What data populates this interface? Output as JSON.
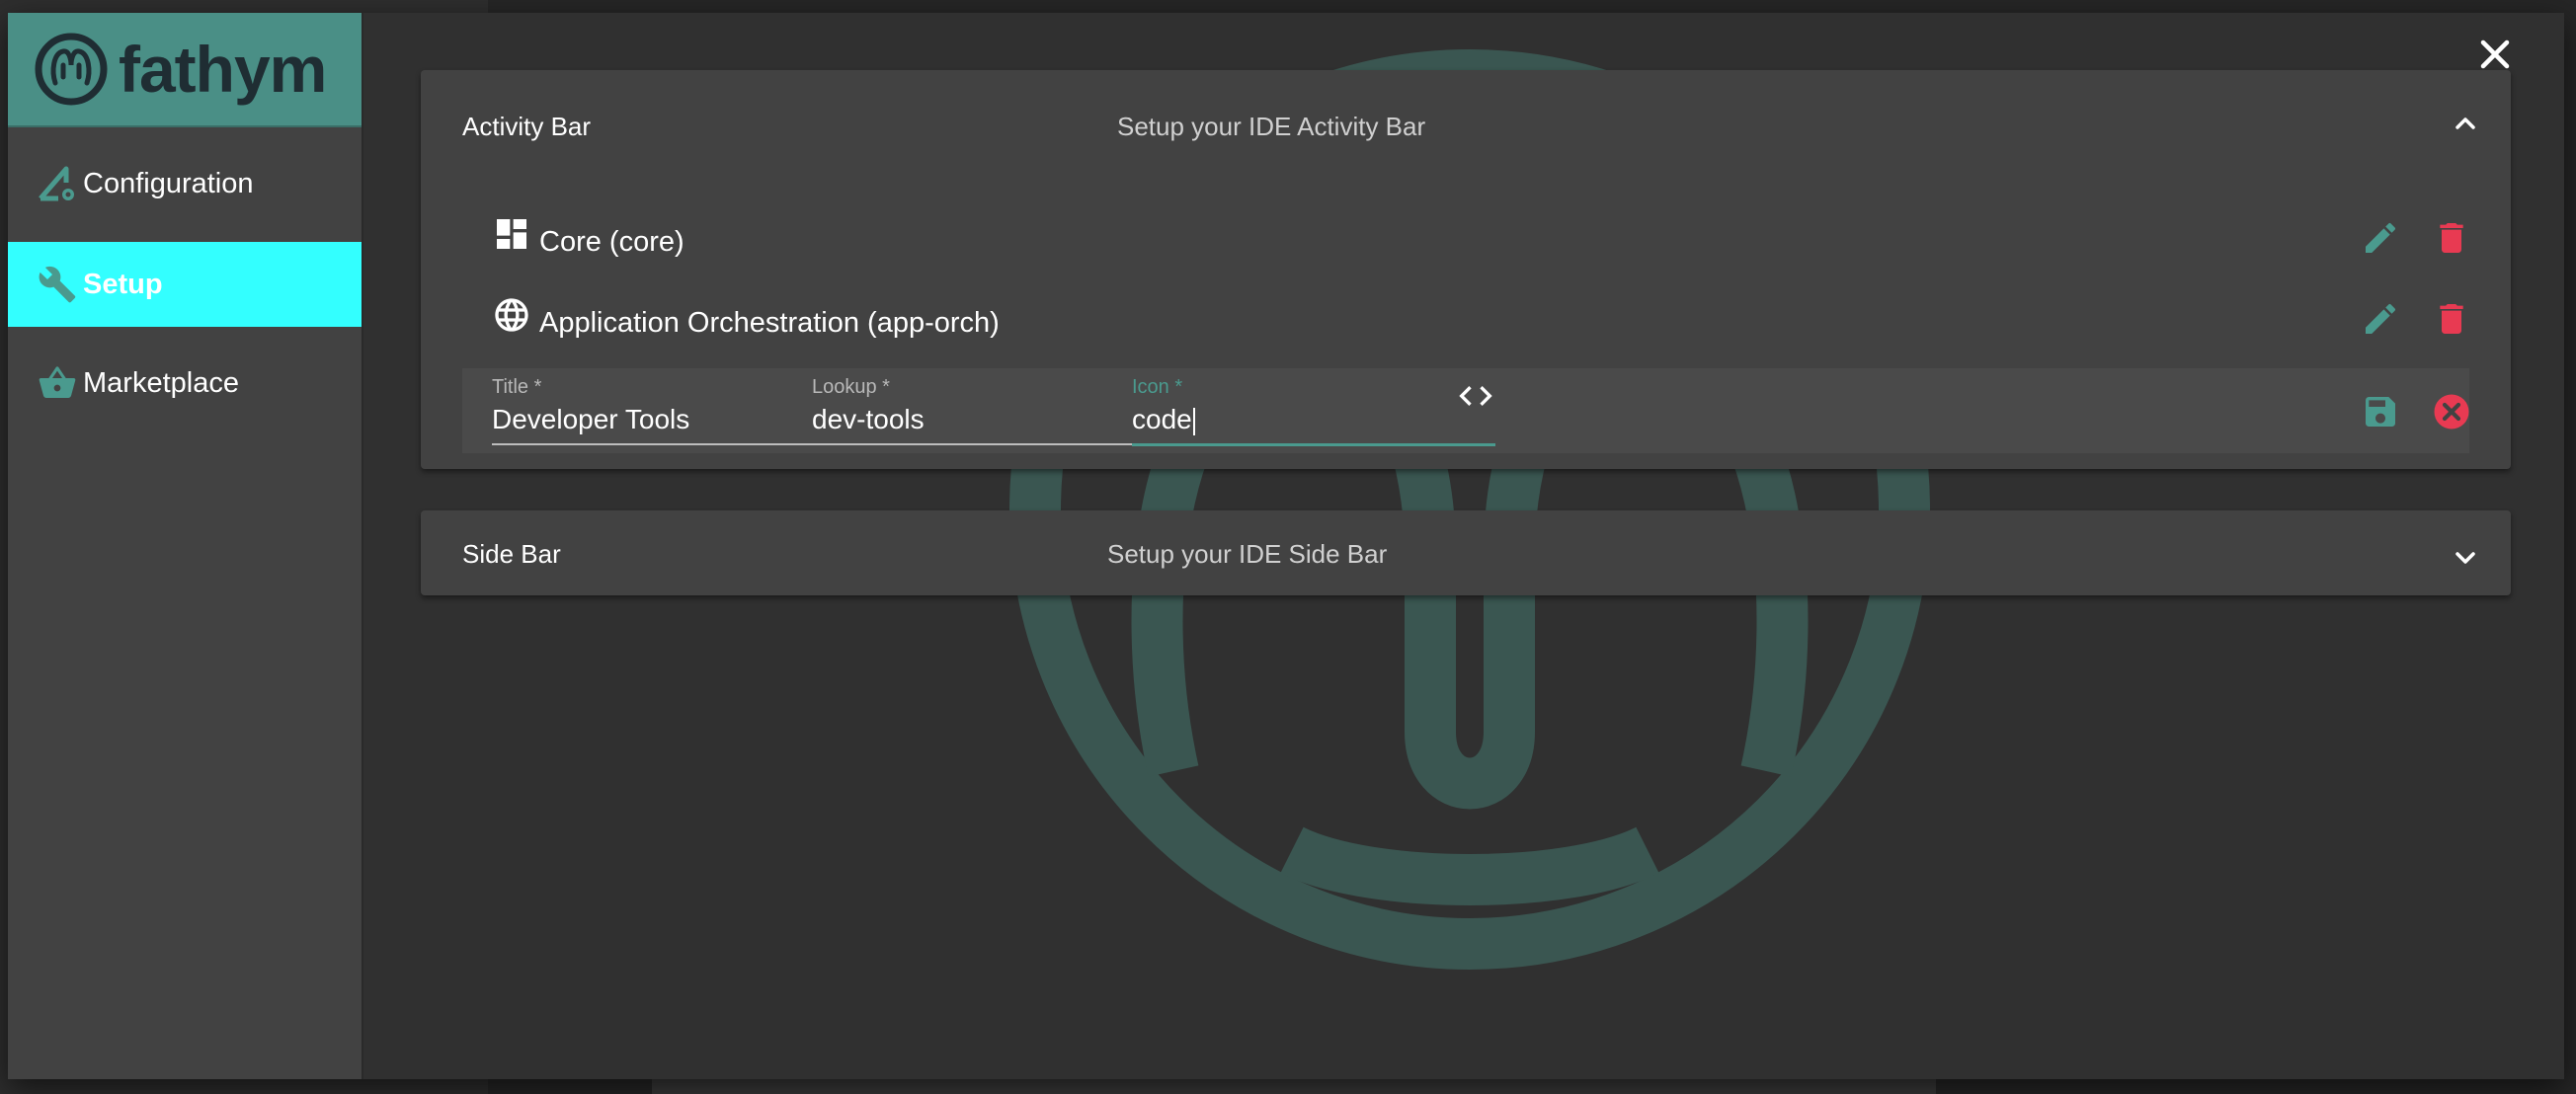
{
  "brand": {
    "name": "fathym",
    "accent": "#33ffff",
    "logo_bg": "#4a8f86",
    "teal": "#4a9a8e",
    "danger": "#e83a52"
  },
  "nav": {
    "items": [
      {
        "label": "Configuration",
        "icon": "settings-triangle-icon",
        "active": false
      },
      {
        "label": "Setup",
        "icon": "wrench-icon",
        "active": true
      },
      {
        "label": "Marketplace",
        "icon": "shopping-basket-icon",
        "active": false
      }
    ]
  },
  "dialog": {
    "close_icon": "close-icon"
  },
  "activity_bar": {
    "title": "Activity Bar",
    "description": "Setup your IDE Activity Bar",
    "toggle_icon": "chevron-up-icon",
    "items": [
      {
        "label": "Core (core)",
        "icon": "dashboard-icon"
      },
      {
        "label": "Application Orchestration (app-orch)",
        "icon": "globe-icon"
      }
    ],
    "edit_form": {
      "title_label": "Title *",
      "title_value": "Developer Tools",
      "lookup_label": "Lookup *",
      "lookup_value": "dev-tools",
      "icon_label": "Icon *",
      "icon_value": "code",
      "icon_preview": "code-icon"
    }
  },
  "side_bar": {
    "title": "Side Bar",
    "description": "Setup your IDE Side Bar",
    "toggle_icon": "chevron-down-icon"
  }
}
